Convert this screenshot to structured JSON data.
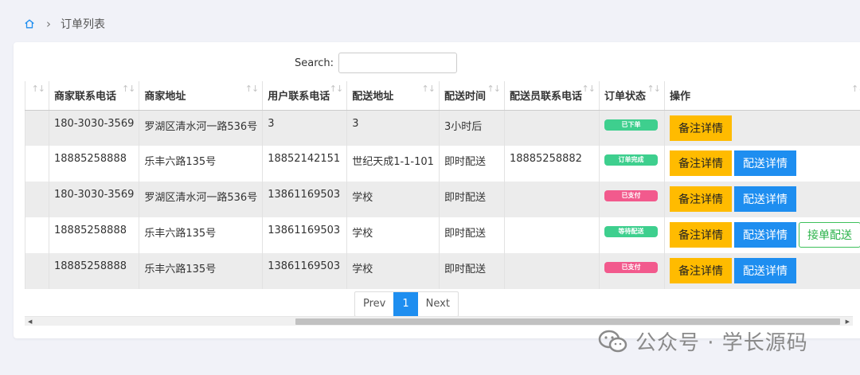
{
  "breadcrumb": {
    "home_icon": "home-icon",
    "separator": "›",
    "current": "订单列表"
  },
  "search": {
    "label": "Search:",
    "value": ""
  },
  "table": {
    "columns": [
      "",
      "商家联系电话",
      "商家地址",
      "用户联系电话",
      "配送地址",
      "配送时间",
      "配送员联系电话",
      "订单状态",
      "操作"
    ],
    "rows": [
      {
        "merchant_phone": "180-3030-3569",
        "merchant_address": "罗湖区清水河一路536号",
        "user_phone": "3",
        "delivery_address": "3",
        "delivery_time": "3小时后",
        "courier_phone": "",
        "status": {
          "text": "已下单",
          "color": "#3ecf8e"
        },
        "actions": [
          "备注详情"
        ]
      },
      {
        "merchant_phone": "18885258888",
        "merchant_address": "乐丰六路135号",
        "user_phone": "18852142151",
        "delivery_address": "世纪天成1-1-101",
        "delivery_time": "即时配送",
        "courier_phone": "18885258882",
        "status": {
          "text": "订单完成",
          "color": "#3ecf8e"
        },
        "actions": [
          "备注详情",
          "配送详情"
        ]
      },
      {
        "merchant_phone": "180-3030-3569",
        "merchant_address": "罗湖区清水河一路536号",
        "user_phone": "13861169503",
        "delivery_address": "学校",
        "delivery_time": "即时配送",
        "courier_phone": "",
        "status": {
          "text": "已支付",
          "color": "#f25a8d"
        },
        "actions": [
          "备注详情",
          "配送详情"
        ]
      },
      {
        "merchant_phone": "18885258888",
        "merchant_address": "乐丰六路135号",
        "user_phone": "13861169503",
        "delivery_address": "学校",
        "delivery_time": "即时配送",
        "courier_phone": "",
        "status": {
          "text": "等待配送",
          "color": "#3ecf8e"
        },
        "actions": [
          "备注详情",
          "配送详情",
          "接单配送"
        ]
      },
      {
        "merchant_phone": "18885258888",
        "merchant_address": "乐丰六路135号",
        "user_phone": "13861169503",
        "delivery_address": "学校",
        "delivery_time": "即时配送",
        "courier_phone": "",
        "status": {
          "text": "已支付",
          "color": "#f25a8d"
        },
        "actions": [
          "备注详情",
          "配送详情"
        ]
      }
    ]
  },
  "pagination": {
    "prev": "Prev",
    "current": "1",
    "next": "Next"
  },
  "watermark": {
    "icon": "wechat-icon",
    "text": "公众号 · 学长源码"
  },
  "colors": {
    "accent_blue": "#1e8ef0",
    "orange": "#ffbb00",
    "green": "#3ecf8e",
    "pink": "#f25a8d"
  }
}
